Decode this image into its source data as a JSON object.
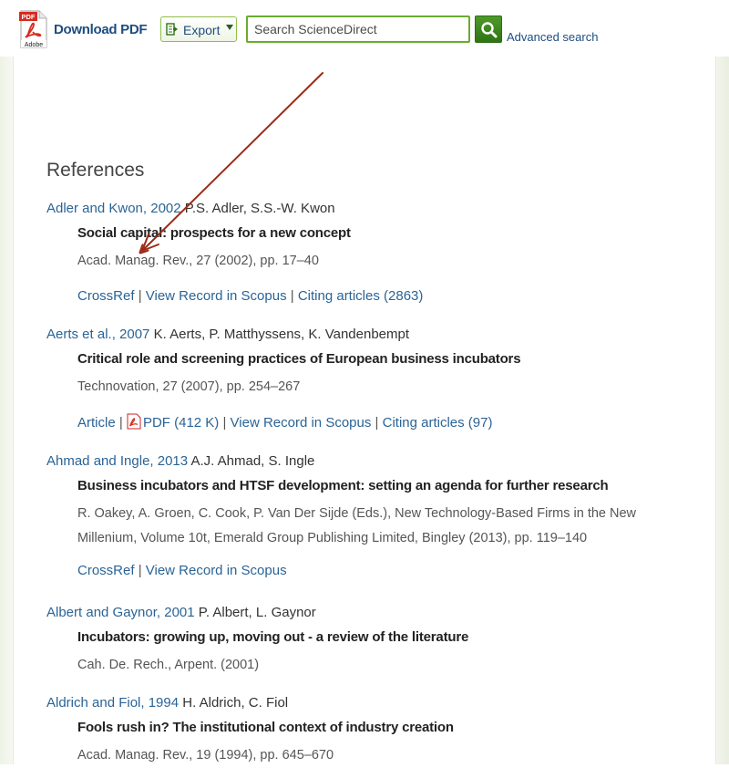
{
  "toolbar": {
    "download_pdf_label": "Download PDF",
    "pdf_icon_text": "PDF",
    "pdf_icon_brand": "Adobe",
    "export_label": "Export",
    "search_placeholder": "Search ScienceDirect",
    "advanced_search_label": "Advanced search"
  },
  "cut_text_fragment": "                         ",
  "references": {
    "heading": "References",
    "items": [
      {
        "cite": "Adler and Kwon, 2002",
        "authors": "P.S. Adler, S.S.-W. Kwon",
        "title": "Social capital: prospects for a new concept",
        "source": "Acad. Manag. Rev., 27 (2002), pp. 17–40",
        "links": [
          "CrossRef",
          "View Record in Scopus",
          "Citing articles (2863)"
        ]
      },
      {
        "cite": "Aerts et al., 2007",
        "authors": "K. Aerts, P. Matthyssens, K. Vandenbempt",
        "title": "Critical role and screening practices of European business incubators",
        "source": "Technovation, 27 (2007), pp. 254–267",
        "links": [
          "Article",
          "PDF (412 K)",
          "View Record in Scopus",
          "Citing articles (97)"
        ]
      },
      {
        "cite": "Ahmad and Ingle, 2013",
        "authors": "A.J. Ahmad, S. Ingle",
        "title": "Business incubators and HTSF development: setting an agenda for further research",
        "source": "R. Oakey, A. Groen, C. Cook, P. Van Der Sijde (Eds.), New Technology-Based Firms in the New Millenium, Volume 10t, Emerald Group Publishing Limited, Bingley (2013), pp. 119–140",
        "links": [
          "CrossRef",
          "View Record in Scopus"
        ]
      },
      {
        "cite": "Albert and Gaynor, 2001",
        "authors": "P. Albert, L. Gaynor",
        "title": "Incubators: growing up, moving out - a review of the literature",
        "source": "Cah. De. Rech., Arpent. (2001)",
        "links": []
      },
      {
        "cite": "Aldrich and Fiol, 1994",
        "authors": "H. Aldrich, C. Fiol",
        "title": "Fools rush in? The institutional context of industry creation",
        "source": "Acad. Manag. Rev., 19 (1994), pp. 645–670",
        "links": []
      }
    ]
  },
  "colors": {
    "link": "#2a6496",
    "brand_green": "#6bab2f",
    "toolbar_link": "#1d4d80",
    "annotation_arrow": "#9b2a16"
  }
}
